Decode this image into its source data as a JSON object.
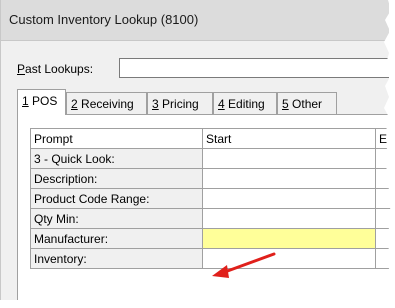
{
  "window": {
    "title": "Custom Inventory Lookup (8100)"
  },
  "past_lookups": {
    "label_accel": "P",
    "label_rest": "ast Lookups:",
    "value": ""
  },
  "tabs": [
    {
      "num": "1",
      "label": " POS",
      "active": true
    },
    {
      "num": "2",
      "label": " Receiving",
      "active": false
    },
    {
      "num": "3",
      "label": " Pricing",
      "active": false
    },
    {
      "num": "4",
      "label": " Editing",
      "active": false
    },
    {
      "num": "5",
      "label": " Other",
      "active": false
    }
  ],
  "grid": {
    "headers": [
      "Prompt",
      "Start",
      "E"
    ],
    "rows": [
      {
        "prompt": "3 - Quick Look:",
        "start": "",
        "highlighted": false
      },
      {
        "prompt": "Description:",
        "start": "",
        "highlighted": false
      },
      {
        "prompt": "Product Code Range:",
        "start": "",
        "highlighted": false
      },
      {
        "prompt": "Qty Min:",
        "start": "",
        "highlighted": false
      },
      {
        "prompt": "Manufacturer:",
        "start": "",
        "highlighted": true
      },
      {
        "prompt": "Inventory:",
        "start": "",
        "highlighted": false
      }
    ]
  },
  "colors": {
    "highlight": "#ffff99",
    "arrow": "#e0201b"
  }
}
